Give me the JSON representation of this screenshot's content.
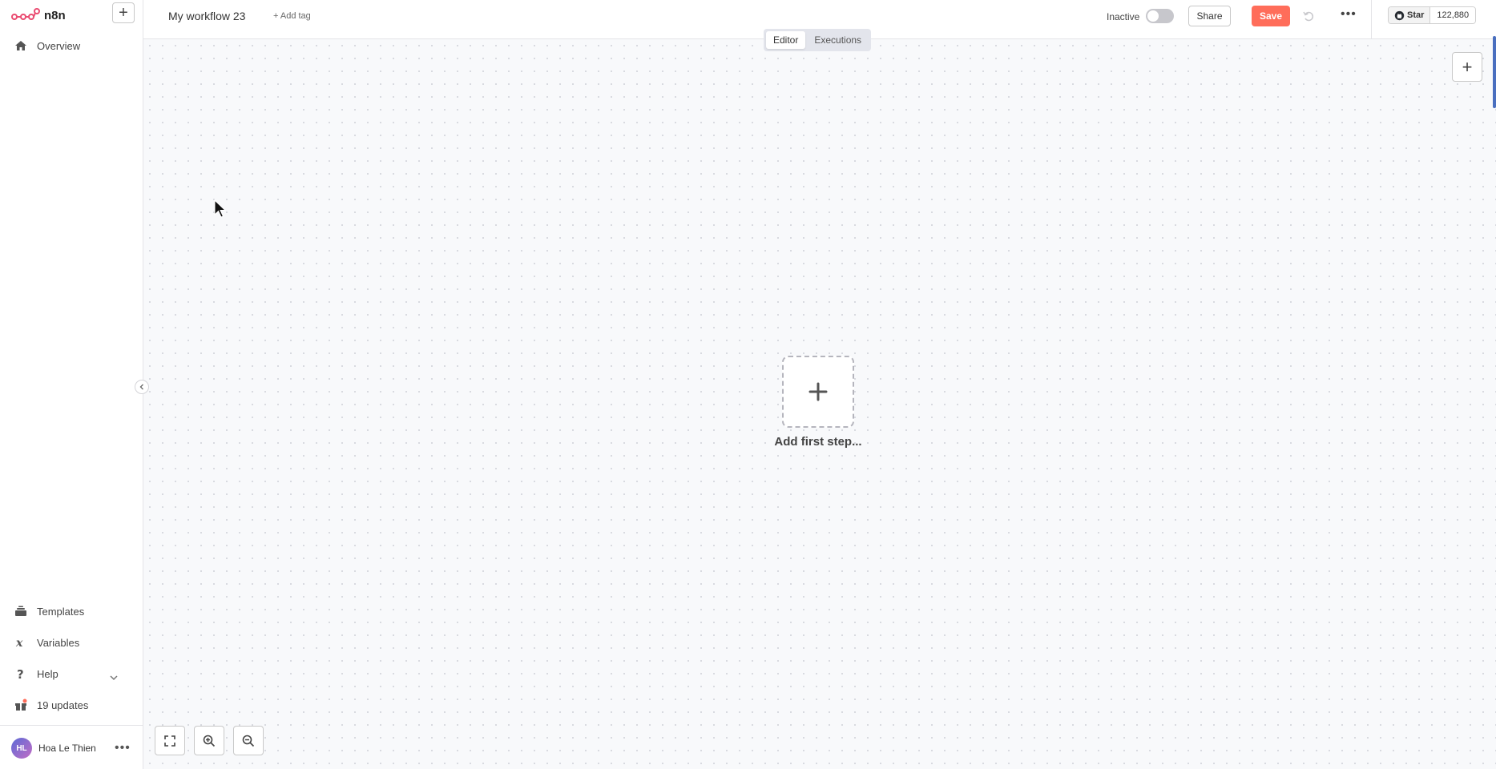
{
  "app": {
    "logo_text": "n8n",
    "brand_color": "#ff6d5a"
  },
  "sidebar": {
    "add_label": "+",
    "top_items": [
      {
        "label": "Overview",
        "icon": "home-icon"
      }
    ],
    "bottom_items": [
      {
        "label": "Templates",
        "icon": "templates-icon"
      },
      {
        "label": "Variables",
        "icon": "variables-icon"
      },
      {
        "label": "Help",
        "icon": "help-icon"
      },
      {
        "label": "19 updates",
        "icon": "gift-icon"
      }
    ],
    "user": {
      "initials": "HL",
      "name": "Hoa Le Thien",
      "more": "•••"
    }
  },
  "header": {
    "workflow_name": "My workflow 23",
    "add_tag": "+ Add tag",
    "active_label": "Inactive",
    "share_label": "Share",
    "save_label": "Save",
    "more": "•••",
    "github": {
      "star_label": "Star",
      "star_count": "122,880"
    }
  },
  "canvas": {
    "tabs": [
      {
        "label": "Editor",
        "active": true
      },
      {
        "label": "Executions",
        "active": false
      }
    ],
    "add_node_label": "+",
    "first_step_label": "Add first step..."
  }
}
